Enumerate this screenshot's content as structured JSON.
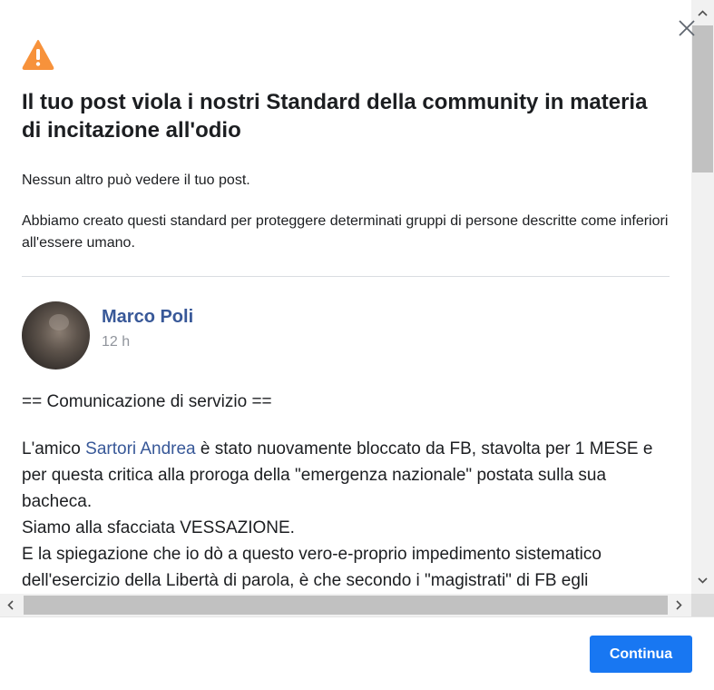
{
  "dialog": {
    "title": "Il tuo post viola i nostri Standard della community in materia di incitazione all'odio",
    "paragraph_1": "Nessun altro può vedere il tuo post.",
    "paragraph_2": "Abbiamo creato questi standard per proteggere determinati gruppi di persone descritte come inferiori all'essere umano.",
    "warning_icon": "warning-triangle-icon",
    "warning_color": "#f7923b",
    "close_icon": "close-icon"
  },
  "post": {
    "author": "Marco Poli",
    "timestamp": "12 h",
    "line_1": "== Comunicazione di servizio ==",
    "para_prefix": "L'amico ",
    "mention": "Sartori Andrea",
    "para_suffix": " è stato nuovamente bloccato da FB, stavolta per 1 MESE e per questa critica alla proroga della \"emergenza nazionale\" postata sulla sua bacheca.",
    "line_3": "Siamo alla sfacciata VESSAZIONE.",
    "line_4": "E la spiegazione che io dò a questo vero-e-proprio impedimento sistematico dell'esercizio della Libertà di parola, è che secondo i \"magistrati\" di FB egli"
  },
  "footer": {
    "continue_label": "Continua",
    "button_color": "#1877f2"
  }
}
